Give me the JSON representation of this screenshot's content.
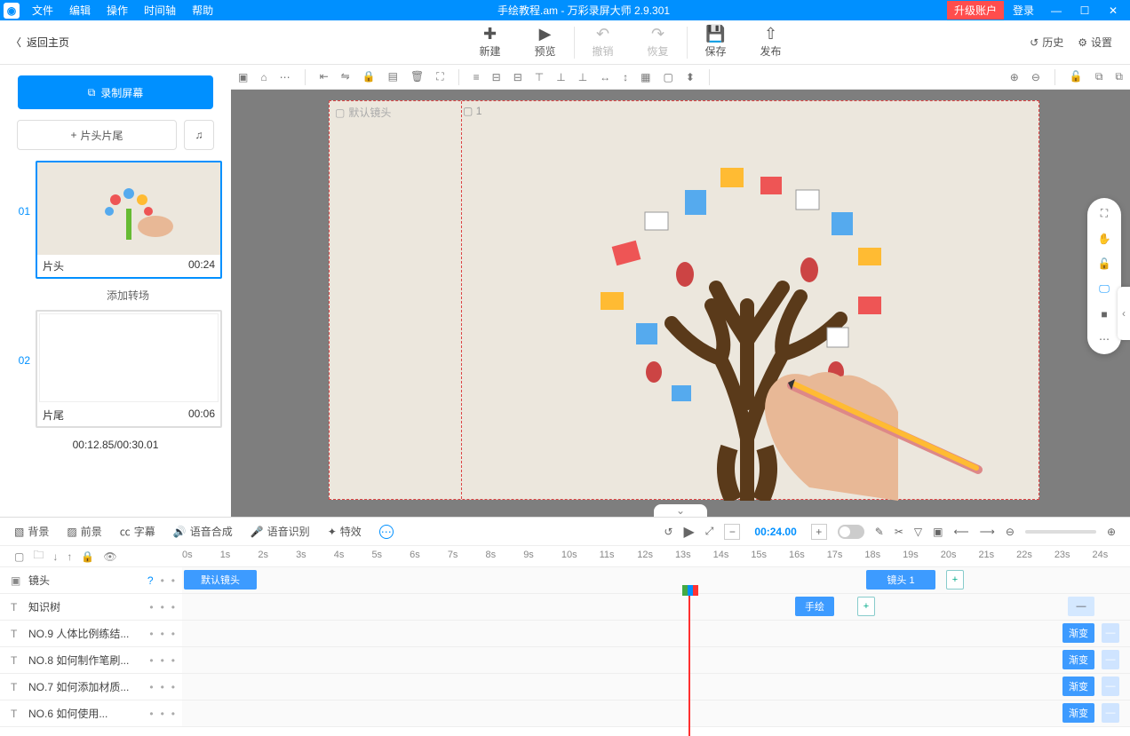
{
  "titlebar": {
    "menus": [
      "文件",
      "编辑",
      "操作",
      "时间轴",
      "帮助"
    ],
    "doc": "手绘教程.am",
    "app": "万彩录屏大师 2.9.301",
    "upgrade": "升级账户",
    "login": "登录"
  },
  "toolbar": {
    "back": "返回主页",
    "new": "新建",
    "preview": "预览",
    "undo": "撤销",
    "redo": "恢复",
    "save": "保存",
    "publish": "发布",
    "history": "历史",
    "settings": "设置"
  },
  "left": {
    "record": "录制屏幕",
    "headfoot": "片头片尾",
    "scene1": {
      "num": "01",
      "name": "片头",
      "dur": "00:24"
    },
    "transition": "添加转场",
    "scene2": {
      "num": "02",
      "name": "片尾",
      "dur": "00:06"
    },
    "time": "00:12.85/00:30.01"
  },
  "canvas": {
    "defcam": "默认镜头",
    "cam1": "1"
  },
  "tl": {
    "tabs": {
      "bg": "背景",
      "fg": "前景",
      "sub": "字幕",
      "tts": "语音合成",
      "asr": "语音识别",
      "fx": "特效"
    },
    "time": "00:24.00",
    "ticks": [
      "0s",
      "1s",
      "2s",
      "3s",
      "4s",
      "5s",
      "6s",
      "7s",
      "8s",
      "9s",
      "10s",
      "11s",
      "12s",
      "13s",
      "14s",
      "15s",
      "16s",
      "17s",
      "18s",
      "19s",
      "20s",
      "21s",
      "22s",
      "23s",
      "24s"
    ],
    "tracks": {
      "cam": "镜头",
      "t1": "知识树",
      "t2": "NO.9  人体比例练结...",
      "t3": "NO.8  如何制作笔刷...",
      "t4": "NO.7  如何添加材质...",
      "t5": "NO.6  如何使用..."
    },
    "clips": {
      "defcam": "默认镜头",
      "cam1": "镜头 1",
      "hand": "手绘",
      "fade": "渐变",
      "minus": "—",
      "plus": "+"
    }
  }
}
